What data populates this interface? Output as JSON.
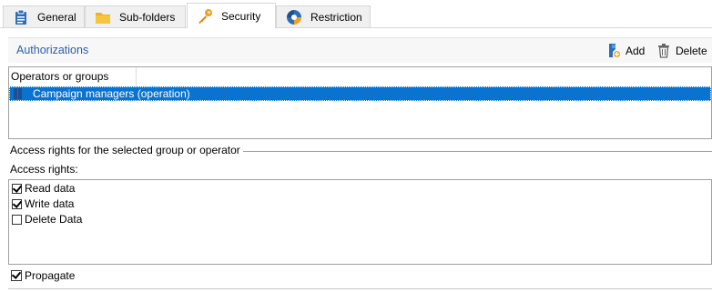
{
  "tabs": [
    {
      "label": "General",
      "icon": "clipboard-icon"
    },
    {
      "label": "Sub-folders",
      "icon": "folder-icon"
    },
    {
      "label": "Security",
      "icon": "key-icon",
      "active": true
    },
    {
      "label": "Restriction",
      "icon": "restriction-icon"
    }
  ],
  "authorizations": {
    "title": "Authorizations",
    "add_label": "Add",
    "delete_label": "Delete"
  },
  "grid": {
    "column_header": "Operators or groups",
    "rows": [
      {
        "label": "Campaign managers (operation)",
        "selected": true
      }
    ]
  },
  "access": {
    "group_title": "Access rights for the selected group or operator",
    "rights_label": "Access rights:",
    "items": [
      {
        "label": "Read data",
        "checked": true
      },
      {
        "label": "Write data",
        "checked": true
      },
      {
        "label": "Delete Data",
        "checked": false
      }
    ]
  },
  "propagate": {
    "label": "Propagate",
    "checked": true
  },
  "colors": {
    "accent": "#2b5faa",
    "selection": "#0a73d0"
  }
}
